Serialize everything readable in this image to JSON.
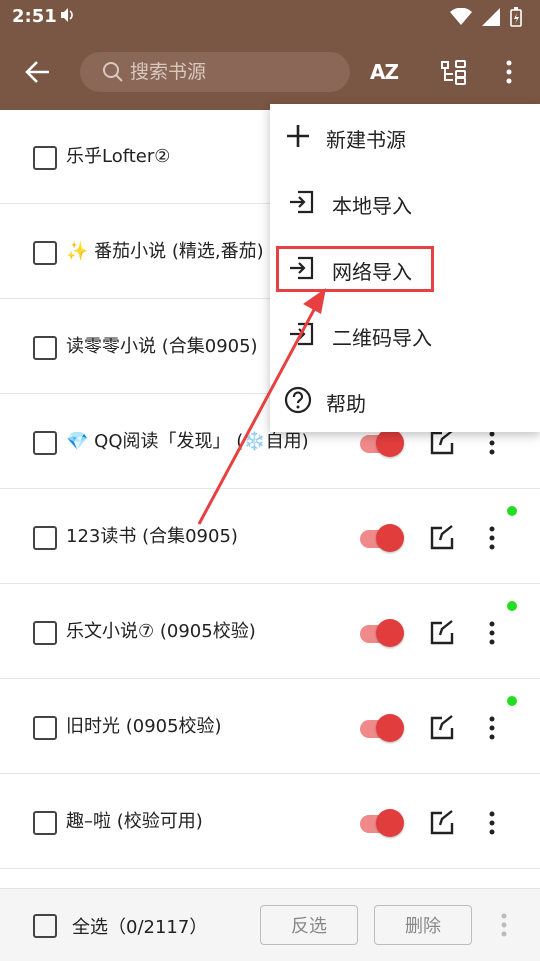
{
  "status_bar": {
    "time": "2:51"
  },
  "app_bar": {
    "search_placeholder": "搜索书源",
    "sort_label": "AZ"
  },
  "sources": [
    {
      "name": "乐乎Lofter②",
      "enabled": true,
      "indicator": false
    },
    {
      "name": "番茄小说 (精选,番茄)",
      "enabled": true,
      "indicator": false,
      "emoji": "✨"
    },
    {
      "name": "读零零小说 (合集0905)",
      "enabled": true,
      "indicator": false
    },
    {
      "name": "QQ阅读「发现」 (",
      "name_suffix": "自用)",
      "enabled": true,
      "indicator": false,
      "emoji": "💎",
      "emoji2": "❄️"
    },
    {
      "name": "123读书 (合集0905)",
      "enabled": true,
      "indicator": true
    },
    {
      "name": "乐文小说⑦ (0905校验)",
      "enabled": true,
      "indicator": true
    },
    {
      "name": "旧时光 (0905校验)",
      "enabled": true,
      "indicator": true
    },
    {
      "name": "趣–啦 (校验可用)",
      "enabled": true,
      "indicator": false
    }
  ],
  "bottom_bar": {
    "select_all_label": "全选（0/2117）",
    "invert_label": "反选",
    "delete_label": "删除"
  },
  "menu": {
    "items": [
      {
        "label": "新建书源",
        "icon": "plus-icon"
      },
      {
        "label": "本地导入",
        "icon": "import-icon"
      },
      {
        "label": "网络导入",
        "icon": "import-icon",
        "highlighted": true
      },
      {
        "label": "二维码导入",
        "icon": "import-icon"
      },
      {
        "label": "帮助",
        "icon": "help-icon"
      }
    ]
  },
  "colors": {
    "primary": "#7a5744",
    "toggle_on": "#e23d3d",
    "indicator": "#22dd22",
    "annotation": "#e84040"
  }
}
